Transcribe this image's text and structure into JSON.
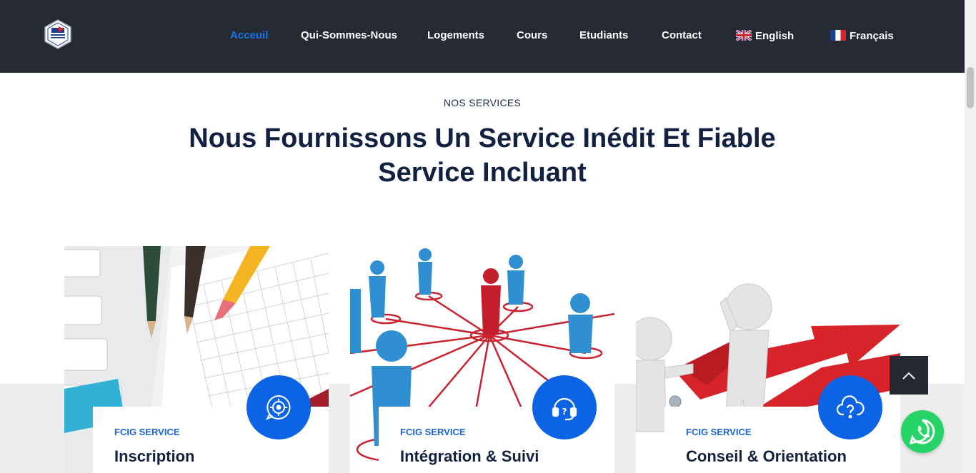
{
  "header": {
    "nav": [
      {
        "label": "Acceuil",
        "active": true
      },
      {
        "label": "Qui-Sommes-Nous"
      },
      {
        "label": "Logements"
      },
      {
        "label": "Cours"
      },
      {
        "label": "Etudiants"
      },
      {
        "label": "Contact"
      }
    ],
    "languages": [
      {
        "label": "English",
        "flag": "uk-flag-icon"
      },
      {
        "label": "Français",
        "flag": "france-flag-icon"
      }
    ]
  },
  "section": {
    "kicker": "NOS SERVICES",
    "title_line1": "Nous Fournissons Un Service Inédit Et Fiable",
    "title_line2": "Service Incluant"
  },
  "cards": [
    {
      "tag": "FCIG SERVICE",
      "title": "Inscription",
      "icon": "target-chat-icon"
    },
    {
      "tag": "FCIG SERVICE",
      "title": "Intégration & Suivi",
      "icon": "headset-icon"
    },
    {
      "tag": "FCIG SERVICE",
      "title": "Conseil & Orientation",
      "icon": "cloud-question-icon"
    }
  ],
  "colors": {
    "header_bg": "#262b33",
    "accent": "#1a73e8",
    "title": "#12213f",
    "icon_bg": "#0b63e5",
    "whatsapp": "#25d366"
  }
}
